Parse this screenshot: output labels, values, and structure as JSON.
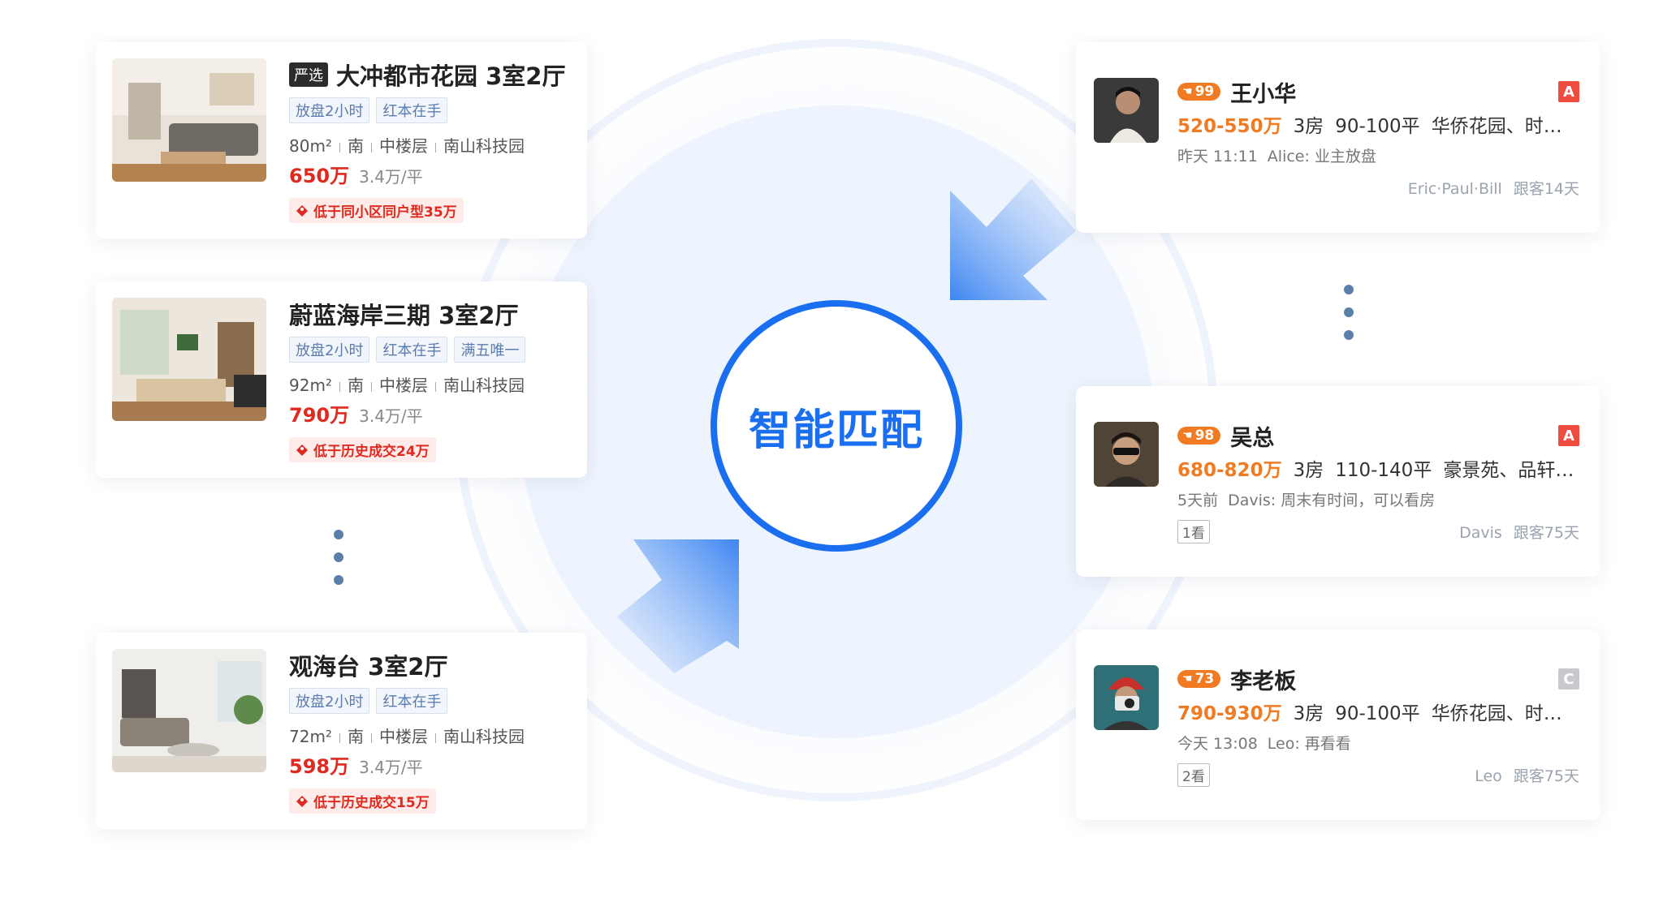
{
  "center": {
    "label": "智能匹配"
  },
  "properties": [
    {
      "badge": "严选",
      "title": "大冲都市花园 3室2厅",
      "tags": [
        "放盘2小时",
        "红本在手"
      ],
      "area": "80m²",
      "direction": "南",
      "floor": "中楼层",
      "district": "南山科技园",
      "price": "650万",
      "unit_price": "3.4万/平",
      "note": "低于同小区同户型35万"
    },
    {
      "badge": "",
      "title": "蔚蓝海岸三期 3室2厅",
      "tags": [
        "放盘2小时",
        "红本在手",
        "满五唯一"
      ],
      "area": "92m²",
      "direction": "南",
      "floor": "中楼层",
      "district": "南山科技园",
      "price": "790万",
      "unit_price": "3.4万/平",
      "note": "低于历史成交24万"
    },
    {
      "badge": "",
      "title": "观海台 3室2厅",
      "tags": [
        "放盘2小时",
        "红本在手"
      ],
      "area": "72m²",
      "direction": "南",
      "floor": "中楼层",
      "district": "南山科技园",
      "price": "598万",
      "unit_price": "3.4万/平",
      "note": "低于历史成交15万"
    }
  ],
  "customers": [
    {
      "score": "99",
      "name": "王小华",
      "grade": "A",
      "grade_color": "#ef4b3f",
      "budget": "520-550万",
      "rooms": "3房",
      "size": "90-100平",
      "areas": "华侨花园、时…",
      "time": "昨天 11:11",
      "message": "Alice: 业主放盘",
      "views": "",
      "agents": "Eric·Paul·Bill",
      "follow_days": "跟客14天"
    },
    {
      "score": "98",
      "name": "吴总",
      "grade": "A",
      "grade_color": "#ef4b3f",
      "budget": "680-820万",
      "rooms": "3房",
      "size": "110-140平",
      "areas": "豪景苑、品轩…",
      "time": "5天前",
      "message": "Davis: 周末有时间，可以看房",
      "views": "1看",
      "agents": "Davis",
      "follow_days": "跟客75天"
    },
    {
      "score": "73",
      "name": "李老板",
      "grade": "C",
      "grade_color": "#c7c9cc",
      "budget": "790-930万",
      "rooms": "3房",
      "size": "90-100平",
      "areas": "华侨花园、时…",
      "time": "今天 13:08",
      "message": "Leo: 再看看",
      "views": "2看",
      "agents": "Leo",
      "follow_days": "跟客75天"
    }
  ],
  "colors": {
    "accent": "#1a6ff0",
    "price_red": "#e02a1f",
    "budget_orange": "#f07b22"
  }
}
